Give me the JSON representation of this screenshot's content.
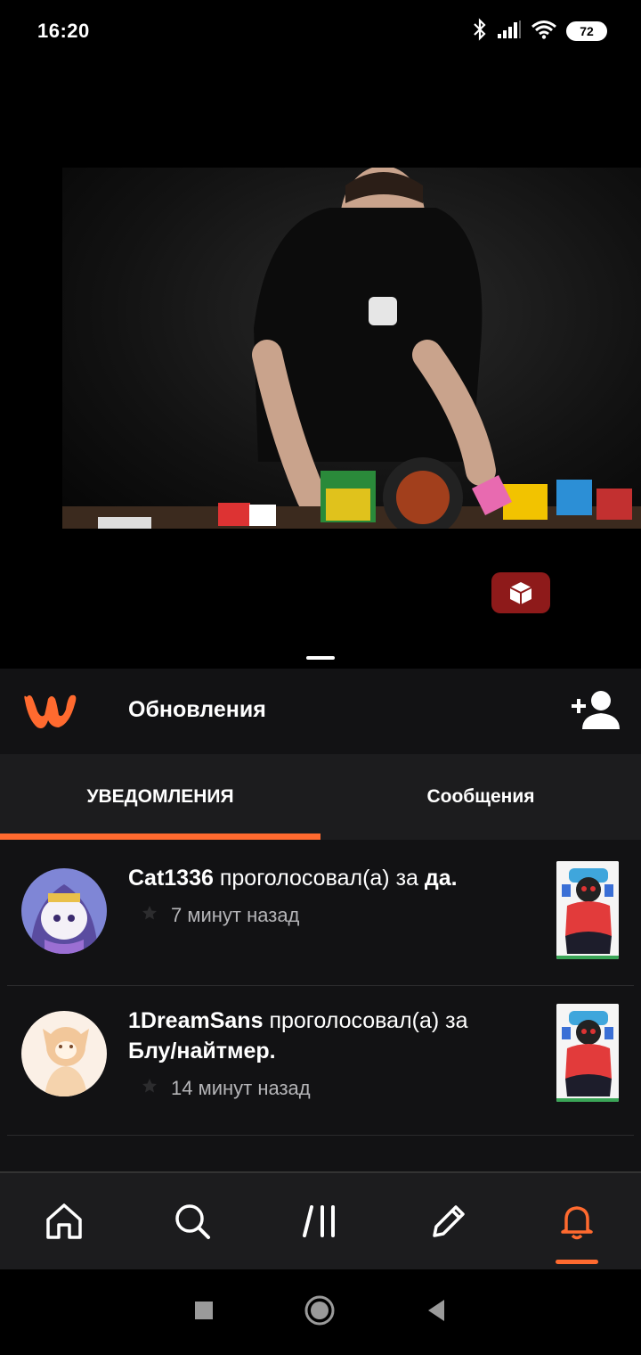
{
  "status_bar": {
    "time": "16:20",
    "battery": "72"
  },
  "header": {
    "title": "Обновления"
  },
  "tabs": [
    {
      "label": "УВЕДОМЛЕНИЯ",
      "active": true
    },
    {
      "label": "Сообщения",
      "active": false
    }
  ],
  "notifications": [
    {
      "user": "Cat1336",
      "action": "проголосовал(а) за",
      "target": "да.",
      "time": "7 минут назад"
    },
    {
      "user": "1DreamSans",
      "action": "проголосовал(а) за",
      "target": "Блу/найтмер.",
      "time": "14 минут назад"
    }
  ],
  "bottom_nav": [
    "home-icon",
    "search-icon",
    "library-icon",
    "write-icon",
    "notifications-icon"
  ],
  "colors": {
    "accent": "#ff6a2f",
    "background": "#121214",
    "tab_bg": "#1c1c1e"
  }
}
